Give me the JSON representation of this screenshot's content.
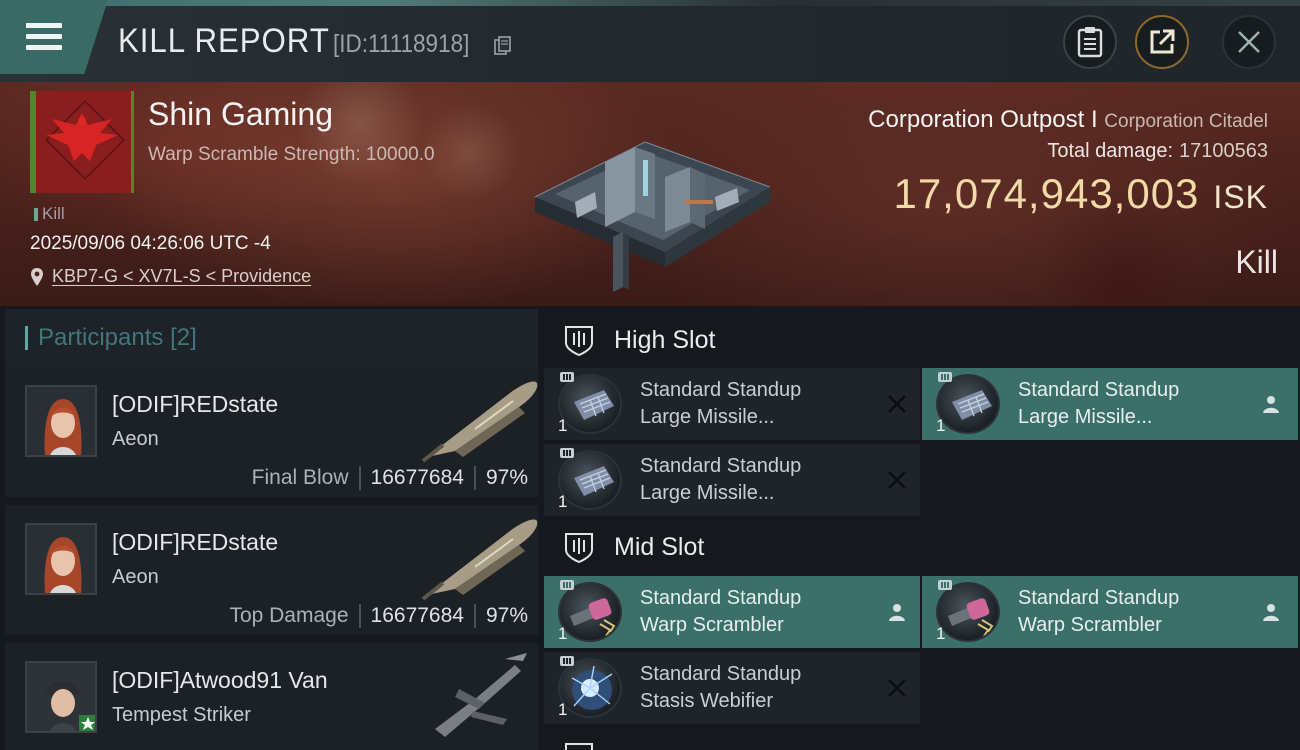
{
  "header": {
    "title": "KILL REPORT",
    "report_id": "[ID:11118918]",
    "icons": [
      "menu-icon",
      "copy-icon",
      "clipboard-icon",
      "share-icon",
      "close-icon"
    ]
  },
  "victim": {
    "corp_name": "Shin Gaming",
    "subtitle": "Warp Scramble Strength: 10000.0",
    "kill_tag": "Kill",
    "timestamp": "2025/09/06 04:26:06 UTC -4",
    "location": "KBP7-G < XV7L-S < Providence",
    "target_type": "Corporation Outpost I",
    "target_class": "Corporation Citadel",
    "total_damage_label": "Total damage:",
    "total_damage": "17100563",
    "isk_value": "17,074,943,003",
    "isk_unit": "ISK",
    "result": "Kill"
  },
  "participants": {
    "label": "Participants",
    "count": "[2]",
    "rows": [
      {
        "name": "[ODIF]REDstate",
        "ship": "Aeon",
        "role": "Final Blow",
        "damage": "16677684",
        "pct": "97%"
      },
      {
        "name": "[ODIF]REDstate",
        "ship": "Aeon",
        "role": "Top Damage",
        "damage": "16677684",
        "pct": "97%"
      },
      {
        "name": "[ODIF]Atwood91 Van",
        "ship": "Tempest Striker",
        "role": "",
        "damage": "",
        "pct": ""
      }
    ]
  },
  "slots": {
    "high": {
      "label": "High Slot",
      "modules": [
        {
          "line1": "Standard Standup",
          "line2": "Large Missile...",
          "qty": "1",
          "status": "destroyed"
        },
        {
          "line1": "Standard Standup",
          "line2": "Large Missile...",
          "qty": "1",
          "status": "dropped"
        },
        {
          "line1": "Standard Standup",
          "line2": "Large Missile...",
          "qty": "1",
          "status": "destroyed"
        }
      ]
    },
    "mid": {
      "label": "Mid Slot",
      "modules": [
        {
          "line1": "Standard Standup",
          "line2": "Warp Scrambler",
          "qty": "1",
          "status": "dropped"
        },
        {
          "line1": "Standard Standup",
          "line2": "Warp Scrambler",
          "qty": "1",
          "status": "dropped"
        },
        {
          "line1": "Standard Standup",
          "line2": "Stasis Webifier",
          "qty": "1",
          "status": "destroyed"
        }
      ]
    }
  },
  "colors": {
    "accent": "#3b6f69",
    "isk": "#f1d9a8",
    "participants_header": "#43757a"
  }
}
